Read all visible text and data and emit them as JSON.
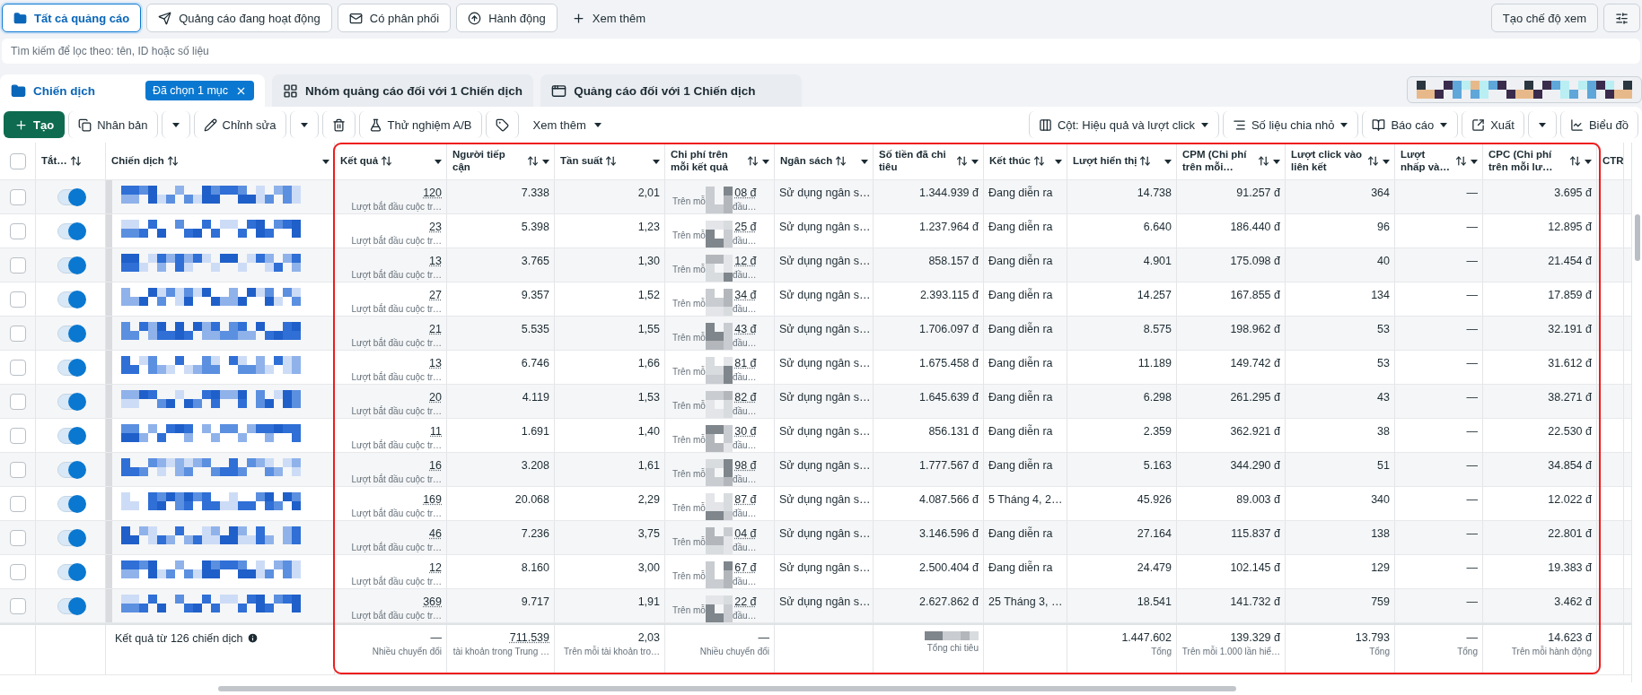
{
  "filters": [
    {
      "kind": "tab",
      "label": "Tất cả quảng cáo",
      "selected": true
    },
    {
      "kind": "tab",
      "label": "Quảng cáo đang hoạt động",
      "selected": false
    },
    {
      "kind": "tab",
      "label": "Có phân phối",
      "selected": false
    },
    {
      "kind": "tab",
      "label": "Hành động",
      "selected": false
    },
    {
      "kind": "more",
      "label": "Xem thêm",
      "selected": false
    }
  ],
  "create_view": "Tạo chế độ xem",
  "search": {
    "placeholder": "Tìm kiếm để lọc theo: tên, ID hoặc số liệu"
  },
  "levels": [
    {
      "label": "Chiến dịch",
      "selected": true,
      "badge": "Đã chọn 1 mục"
    },
    {
      "label": "Nhóm quảng cáo đối với 1 Chiến dịch",
      "selected": false
    },
    {
      "label": "Quảng cáo đối với 1 Chiến dịch",
      "selected": false
    }
  ],
  "toolbar_left": [
    {
      "kind": "primary",
      "label": "Tạo"
    },
    {
      "kind": "button",
      "label": "Nhân bản"
    },
    {
      "kind": "caret"
    },
    {
      "kind": "button",
      "label": "Chỉnh sửa"
    },
    {
      "kind": "caret"
    },
    {
      "kind": "icon"
    },
    {
      "kind": "button",
      "label": "Thử nghiệm A/B"
    },
    {
      "kind": "icon"
    },
    {
      "kind": "menu",
      "label": "Xem thêm"
    }
  ],
  "toolbar_right": [
    {
      "kind": "menu",
      "label": "Cột: Hiệu quả và lượt click"
    },
    {
      "kind": "menu",
      "label": "Số liệu chia nhỏ"
    },
    {
      "kind": "menu",
      "label": "Báo cáo"
    },
    {
      "kind": "button",
      "label": "Xuất"
    },
    {
      "kind": "caret"
    },
    {
      "kind": "button",
      "label": "Biểu đồ"
    }
  ],
  "table": {
    "header_checked": false,
    "columns": [
      {
        "label": "Tắt…"
      },
      {
        "label": "Chiến dịch"
      },
      {
        "label": "Kết quả"
      },
      {
        "label": "Người tiếp cận"
      },
      {
        "label": "Tần suất"
      },
      {
        "label": "Chi phí trên mỗi kết quả"
      },
      {
        "label": "Ngân sách"
      },
      {
        "label": "Số tiền đã chi tiêu"
      },
      {
        "label": "Kết thúc"
      },
      {
        "label": "Lượt hiển thị"
      },
      {
        "label": "CPM (Chi phí trên mỗi…"
      },
      {
        "label": "Lượt click vào liên kết"
      },
      {
        "label": "Lượt nhấp và…"
      },
      {
        "label": "CPC (Chi phí trên mỗi lư…"
      },
      {
        "label": "CTR"
      }
    ],
    "rows": [
      {
        "checked": false,
        "on": true,
        "result": "120",
        "result_note": "Lượt bắt đầu cuộc tr…",
        "reach": "7.338",
        "frequency": "2,01",
        "cost": "08 đ",
        "cost_note_start": "Trên mỗ",
        "cost_note_end": "đầu…",
        "budget": "Sử dụng ngân s…",
        "spent": "1.344.939 đ",
        "end": "Đang diễn ra",
        "impressions": "14.738",
        "cpm": "91.257 đ",
        "link_clicks": "364",
        "clicks_all": "—",
        "cpc": "3.695 đ"
      },
      {
        "checked": false,
        "on": true,
        "result": "23",
        "result_note": "Lượt bắt đầu cuộc tr…",
        "reach": "5.398",
        "frequency": "1,23",
        "cost": "25 đ",
        "cost_note_start": "Trên mỗ",
        "cost_note_end": "đầu…",
        "budget": "Sử dụng ngân s…",
        "spent": "1.237.964 đ",
        "end": "Đang diễn ra",
        "impressions": "6.640",
        "cpm": "186.440 đ",
        "link_clicks": "96",
        "clicks_all": "—",
        "cpc": "12.895 đ"
      },
      {
        "checked": false,
        "on": true,
        "result": "13",
        "result_note": "Lượt bắt đầu cuộc tr…",
        "reach": "3.765",
        "frequency": "1,30",
        "cost": "12 đ",
        "cost_note_start": "Trên mỗ",
        "cost_note_end": "đầu…",
        "budget": "Sử dụng ngân s…",
        "spent": "858.157 đ",
        "end": "Đang diễn ra",
        "impressions": "4.901",
        "cpm": "175.098 đ",
        "link_clicks": "40",
        "clicks_all": "—",
        "cpc": "21.454 đ"
      },
      {
        "checked": false,
        "on": true,
        "result": "27",
        "result_note": "Lượt bắt đầu cuộc tr…",
        "reach": "9.357",
        "frequency": "1,52",
        "cost": "34 đ",
        "cost_note_start": "Trên mỗ",
        "cost_note_end": "đầu…",
        "budget": "Sử dụng ngân s…",
        "spent": "2.393.115 đ",
        "end": "Đang diễn ra",
        "impressions": "14.257",
        "cpm": "167.855 đ",
        "link_clicks": "134",
        "clicks_all": "—",
        "cpc": "17.859 đ"
      },
      {
        "checked": false,
        "on": true,
        "result": "21",
        "result_note": "Lượt bắt đầu cuộc tr…",
        "reach": "5.535",
        "frequency": "1,55",
        "cost": "43 đ",
        "cost_note_start": "Trên mỗ",
        "cost_note_end": "đầu…",
        "budget": "Sử dụng ngân s…",
        "spent": "1.706.097 đ",
        "end": "Đang diễn ra",
        "impressions": "8.575",
        "cpm": "198.962 đ",
        "link_clicks": "53",
        "clicks_all": "—",
        "cpc": "32.191 đ"
      },
      {
        "checked": false,
        "on": true,
        "result": "13",
        "result_note": "Lượt bắt đầu cuộc tr…",
        "reach": "6.746",
        "frequency": "1,66",
        "cost": "81 đ",
        "cost_note_start": "Trên mỗ",
        "cost_note_end": "đầu…",
        "budget": "Sử dụng ngân s…",
        "spent": "1.675.458 đ",
        "end": "Đang diễn ra",
        "impressions": "11.189",
        "cpm": "149.742 đ",
        "link_clicks": "53",
        "clicks_all": "—",
        "cpc": "31.612 đ"
      },
      {
        "checked": false,
        "on": true,
        "result": "20",
        "result_note": "Lượt bắt đầu cuộc tr…",
        "reach": "4.119",
        "frequency": "1,53",
        "cost": "82 đ",
        "cost_note_start": "Trên mỗ",
        "cost_note_end": "đầu…",
        "budget": "Sử dụng ngân s…",
        "spent": "1.645.639 đ",
        "end": "Đang diễn ra",
        "impressions": "6.298",
        "cpm": "261.295 đ",
        "link_clicks": "43",
        "clicks_all": "—",
        "cpc": "38.271 đ"
      },
      {
        "checked": false,
        "on": true,
        "result": "11",
        "result_note": "Lượt bắt đầu cuộc tr…",
        "reach": "1.691",
        "frequency": "1,40",
        "cost": "30 đ",
        "cost_note_start": "Trên mỗ",
        "cost_note_end": "đầu…",
        "budget": "Sử dụng ngân s…",
        "spent": "856.131 đ",
        "end": "Đang diễn ra",
        "impressions": "2.359",
        "cpm": "362.921 đ",
        "link_clicks": "38",
        "clicks_all": "—",
        "cpc": "22.530 đ"
      },
      {
        "checked": false,
        "on": true,
        "result": "16",
        "result_note": "Lượt bắt đầu cuộc tr…",
        "reach": "3.208",
        "frequency": "1,61",
        "cost": "98 đ",
        "cost_note_start": "Trên mỗ",
        "cost_note_end": "đầu…",
        "budget": "Sử dụng ngân s…",
        "spent": "1.777.567 đ",
        "end": "Đang diễn ra",
        "impressions": "5.163",
        "cpm": "344.290 đ",
        "link_clicks": "51",
        "clicks_all": "—",
        "cpc": "34.854 đ"
      },
      {
        "checked": false,
        "on": true,
        "result": "169",
        "result_note": "Lượt bắt đầu cuộc tr…",
        "reach": "20.068",
        "frequency": "2,29",
        "cost": "87 đ",
        "cost_note_start": "Trên mỗ",
        "cost_note_end": "đầu…",
        "budget": "Sử dụng ngân s…",
        "spent": "4.087.566 đ",
        "end": "5 Tháng 4, 2…",
        "impressions": "45.926",
        "cpm": "89.003 đ",
        "link_clicks": "340",
        "clicks_all": "—",
        "cpc": "12.022 đ"
      },
      {
        "checked": false,
        "on": true,
        "result": "46",
        "result_note": "Lượt bắt đầu cuộc tr…",
        "reach": "7.236",
        "frequency": "3,75",
        "cost": "04 đ",
        "cost_note_start": "Trên mỗ",
        "cost_note_end": "đầu…",
        "budget": "Sử dụng ngân s…",
        "spent": "3.146.596 đ",
        "end": "Đang diễn ra",
        "impressions": "27.164",
        "cpm": "115.837 đ",
        "link_clicks": "138",
        "clicks_all": "—",
        "cpc": "22.801 đ"
      },
      {
        "checked": false,
        "on": true,
        "result": "12",
        "result_note": "Lượt bắt đầu cuộc tr…",
        "reach": "8.160",
        "frequency": "3,00",
        "cost": "67 đ",
        "cost_note_start": "Trên mỗ",
        "cost_note_end": "đầu…",
        "budget": "Sử dụng ngân s…",
        "spent": "2.500.404 đ",
        "end": "Đang diễn ra",
        "impressions": "24.479",
        "cpm": "102.145 đ",
        "link_clicks": "129",
        "clicks_all": "—",
        "cpc": "19.383 đ"
      },
      {
        "checked": false,
        "on": true,
        "result": "369",
        "result_note": "Lượt bắt đầu cuộc tr…",
        "reach": "9.717",
        "frequency": "1,91",
        "cost": "22 đ",
        "cost_note_start": "Trên mỗ",
        "cost_note_end": "đầu…",
        "budget": "Sử dụng ngân s…",
        "spent": "2.627.862 đ",
        "end": "25 Tháng 3, …",
        "impressions": "18.541",
        "cpm": "141.732 đ",
        "link_clicks": "759",
        "clicks_all": "—",
        "cpc": "3.462 đ"
      }
    ],
    "totals": {
      "label": "Kết quả từ 126 chiến dịch",
      "cells": [
        {
          "value": "—",
          "note": "Nhiều chuyển đổi"
        },
        {
          "value": "711.539",
          "note": "tài khoản trong Trung …"
        },
        {
          "value": "2,03",
          "note": "Trên mỗi tài khoản tro…"
        },
        {
          "value": "—",
          "note": "Nhiều chuyển đổi"
        },
        {},
        {
          "note": "Tổng chi tiêu"
        },
        {},
        {
          "value": "1.447.602",
          "note": "Tổng"
        },
        {
          "value": "139.329 đ",
          "note": "Trên mỗi 1.000 lần hiể…"
        },
        {
          "value": "13.793",
          "note": "Tổng"
        },
        {
          "value": "—",
          "note": "Tổng"
        },
        {
          "value": "14.623 đ",
          "note": "Trên mỗi hành động"
        }
      ]
    }
  }
}
